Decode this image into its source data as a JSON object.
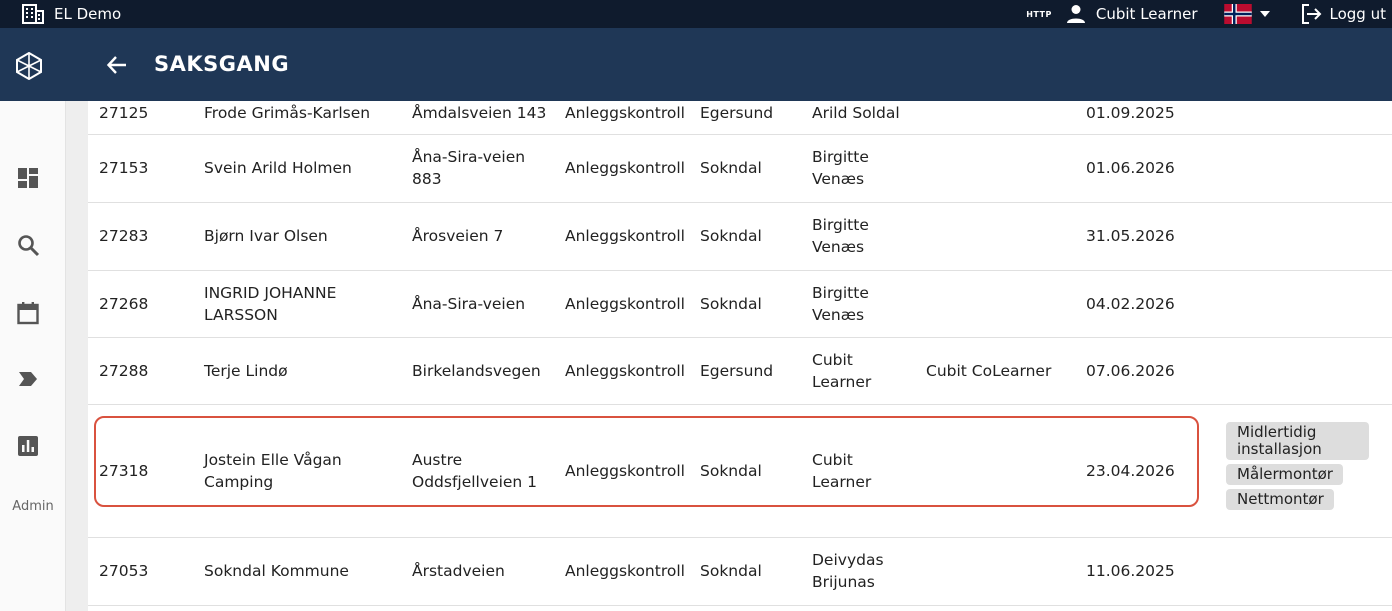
{
  "topbar": {
    "app_title": "EL Demo",
    "http_badge": "HTTP",
    "user_name": "Cubit Learner",
    "logout_label": "Logg ut"
  },
  "header": {
    "title": "SAKSGANG"
  },
  "sidebar": {
    "admin_label": "Admin"
  },
  "rows": [
    {
      "id": "27125",
      "name": "Frode Grimås-Karlsen",
      "address": "Åmdalsveien 143",
      "type": "Anleggskontroll",
      "place": "Egersund",
      "responsible": "Arild Soldal",
      "responsible2": "",
      "date": "01.09.2025"
    },
    {
      "id": "27153",
      "name": "Svein Arild Holmen",
      "address": "Åna-Sira-veien 883",
      "type": "Anleggskontroll",
      "place": "Sokndal",
      "responsible": "Birgitte Venæs",
      "responsible2": "",
      "date": "01.06.2026"
    },
    {
      "id": "27283",
      "name": "Bjørn Ivar Olsen",
      "address": "Årosveien 7",
      "type": "Anleggskontroll",
      "place": "Sokndal",
      "responsible": "Birgitte Venæs",
      "responsible2": "",
      "date": "31.05.2026"
    },
    {
      "id": "27268",
      "name": "INGRID JOHANNE LARSSON",
      "address": "Åna-Sira-veien",
      "type": "Anleggskontroll",
      "place": "Sokndal",
      "responsible": "Birgitte Venæs",
      "responsible2": "",
      "date": "04.02.2026"
    },
    {
      "id": "27288",
      "name": "Terje Lindø",
      "address": "Birkelandsvegen",
      "type": "Anleggskontroll",
      "place": "Egersund",
      "responsible": "Cubit Learner",
      "responsible2": "Cubit CoLearner",
      "date": "07.06.2026"
    },
    {
      "id": "27318",
      "name": "Jostein Elle Vågan Camping",
      "address": "Austre Oddsfjellveien 1",
      "type": "Anleggskontroll",
      "place": "Sokndal",
      "responsible": "Cubit Learner",
      "responsible2": "",
      "date": "23.04.2026",
      "tags": [
        "Midlertidig installasjon",
        "Målermontør",
        "Nettmontør"
      ]
    },
    {
      "id": "27053",
      "name": "Sokndal Kommune",
      "address": "Årstadveien",
      "type": "Anleggskontroll",
      "place": "Sokndal",
      "responsible": "Deivydas Brijunas",
      "responsible2": "",
      "date": "11.06.2025"
    }
  ]
}
